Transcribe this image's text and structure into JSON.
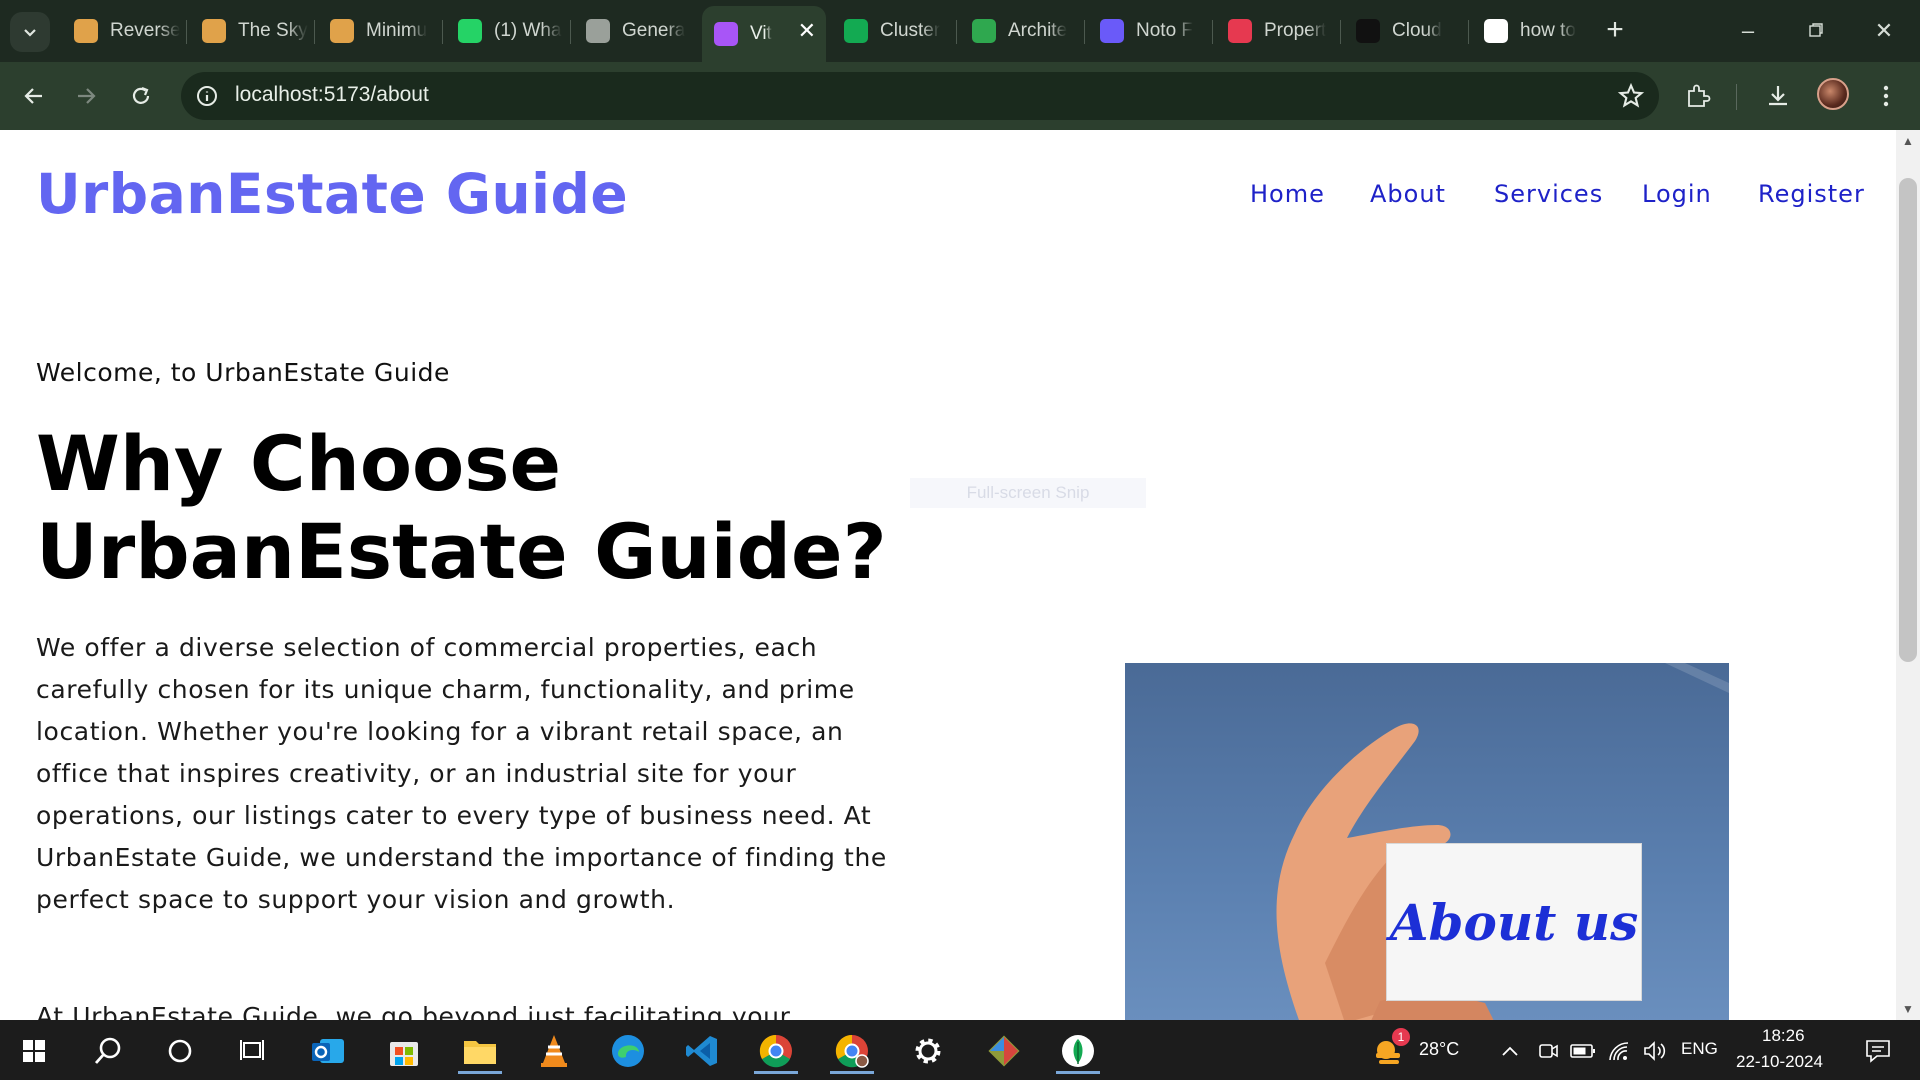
{
  "browser": {
    "tabs": [
      {
        "label": "Reverse",
        "icon": "reverse-icon",
        "color": "#e0a24a",
        "active": false
      },
      {
        "label": "The Sky",
        "icon": "sky-icon",
        "color": "#e0a24a",
        "active": false
      },
      {
        "label": "Minimu",
        "icon": "minimum-icon",
        "color": "#e0a24a",
        "active": false
      },
      {
        "label": "(1) Wha",
        "icon": "whatsapp-icon",
        "color": "#25d366",
        "active": false
      },
      {
        "label": "Genera",
        "icon": "globe-icon",
        "color": "#9aa09a",
        "active": false
      },
      {
        "label": "Vit",
        "icon": "vite-icon",
        "color": "#a855f7",
        "active": true
      },
      {
        "label": "Cluster",
        "icon": "mongodb-icon",
        "color": "#13aa52",
        "active": false
      },
      {
        "label": "Archite",
        "icon": "px-icon",
        "color": "#2fa84f",
        "active": false
      },
      {
        "label": "Noto F",
        "icon": "noto-icon",
        "color": "#6a5af9",
        "active": false
      },
      {
        "label": "Propert",
        "icon": "heart-icon",
        "color": "#e63950",
        "active": false
      },
      {
        "label": "Cloud",
        "icon": "cloud-icon",
        "color": "#111111",
        "active": false
      },
      {
        "label": "how to",
        "icon": "google-icon",
        "color": "#ffffff",
        "active": false
      }
    ],
    "url": "localhost:5173/about"
  },
  "site": {
    "brand": "UrbanEstate Guide",
    "nav": [
      "Home",
      "About",
      "Services",
      "Login",
      "Register"
    ],
    "welcome": "Welcome, to UrbanEstate Guide",
    "heading_line1": "Why Choose",
    "heading_line2": "UrbanEstate Guide?",
    "paragraph1": "We offer a diverse selection of commercial properties, each carefully chosen for its unique charm, functionality, and prime location. Whether you're looking for a vibrant retail space, an office that inspires creativity, or an industrial site for your operations, our listings cater to every type of business need. At UrbanEstate Guide, we understand the importance of finding the perfect space to support your vision and growth.",
    "paragraph2": "At UrbanEstate Guide, we go beyond just facilitating your",
    "image_text": "About us",
    "snip_overlay": "Full-screen Snip"
  },
  "taskbar": {
    "weather_temp": "28°C",
    "weather_badge": "1",
    "language": "ENG",
    "time": "18:26",
    "date": "22-10-2024"
  },
  "colors": {
    "brand": "#6366f1",
    "nav": "#1e22c8",
    "chrome_dark": "#1e2a21",
    "chrome_toolbar": "#2c3f2e"
  }
}
